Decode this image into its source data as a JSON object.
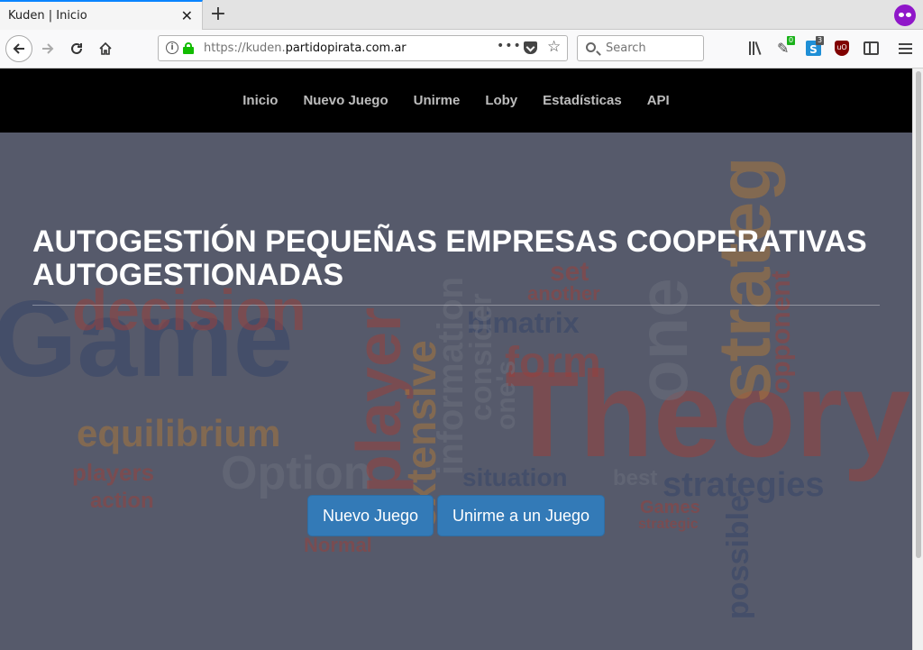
{
  "browser": {
    "tab_title": "Kuden | Inicio",
    "tab_close": "✕",
    "new_tab": "+",
    "url_prefix": "https://kuden.",
    "url_domain": "partidopirata.com.ar",
    "url_more": "•••",
    "search_placeholder": "Search",
    "badge_ext1": "0",
    "badge_ext2": "3",
    "ext2_letter": "S",
    "ublock_label": "uO"
  },
  "site": {
    "nav": [
      "Inicio",
      "Nuevo Juego",
      "Unirme",
      "Loby",
      "Estadísticas",
      "API"
    ],
    "hero_title_line1": "AUTOGESTIÓN PEQUEÑAS EMPRESAS COOPERATIVAS",
    "hero_title_line2": "AUTOGESTIONADAS",
    "btn_new_game": "Nuevo Juego",
    "btn_join_game": "Unirme a un Juego"
  },
  "hero_background": {
    "description_words": [
      "Game",
      "Theory",
      "decision",
      "equilibrium",
      "player",
      "strategies",
      "Option",
      "players",
      "action",
      "information",
      "bimatrix",
      "form",
      "extensive",
      "set",
      "another",
      "one's",
      "situation",
      "Normal",
      "best",
      "possible",
      "strategic",
      "consider",
      "Games",
      "opponent"
    ],
    "colors": {
      "red": "#c0392b",
      "orange": "#d98a2b",
      "navy": "#2b3e6e",
      "grey": "#7b7f8c"
    }
  }
}
